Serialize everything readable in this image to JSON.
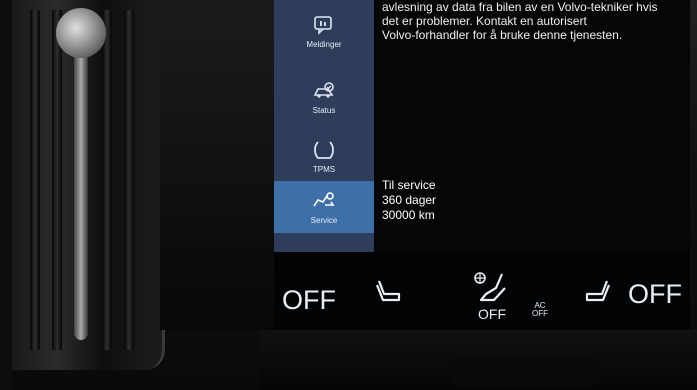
{
  "sidebar": {
    "items": [
      {
        "label": "Meldinger",
        "icon": "messages-icon",
        "active": false
      },
      {
        "label": "Status",
        "icon": "status-icon",
        "active": false
      },
      {
        "label": "TPMS",
        "icon": "tire-pressure-icon",
        "active": false
      },
      {
        "label": "Service",
        "icon": "service-icon",
        "active": true
      }
    ]
  },
  "main": {
    "top_text": [
      "avlesning av data fra bilen av en Volvo-tekniker hvis",
      "det er problemer. Kontakt en autorisert",
      "Volvo-forhandler for å bruke denne tjenesten."
    ],
    "service": {
      "title": "Til service",
      "days": "360 dager",
      "distance": "30000 km"
    }
  },
  "climate": {
    "left_off": "OFF",
    "right_off": "OFF",
    "fan_off": "OFF",
    "ac_line1": "AC",
    "ac_line2": "OFF"
  },
  "colors": {
    "sidebar_bg": "#2d3d5a",
    "active_item": "#3f6fa8",
    "screen_bg": "#050608"
  }
}
